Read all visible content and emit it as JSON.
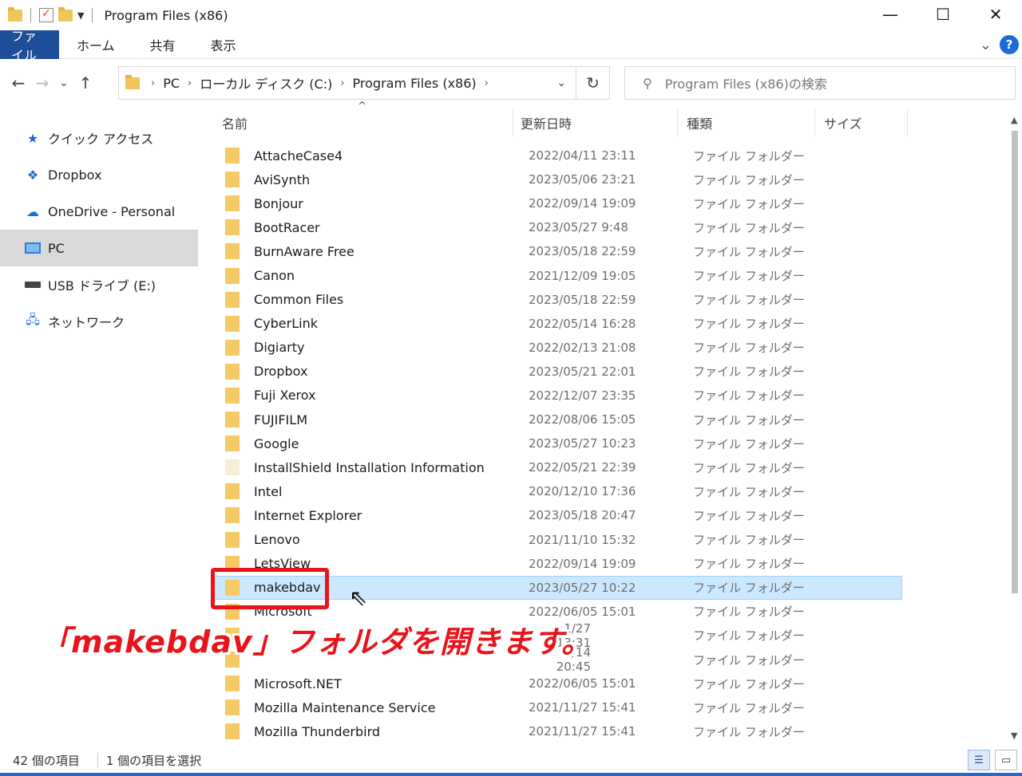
{
  "window": {
    "title": "Program Files (x86)",
    "minimize": "—",
    "maximize": "☐",
    "close": "✕"
  },
  "ribbon": {
    "tabs": [
      "ファイル",
      "ホーム",
      "共有",
      "表示"
    ],
    "expand": "⌄",
    "help": "?"
  },
  "nav": {
    "back": "←",
    "forward": "→",
    "recent": "⌄",
    "up": "↑",
    "breadcrumb": [
      "PC",
      "ローカル ディスク (C:)",
      "Program Files (x86)"
    ],
    "refresh": "↻",
    "search_placeholder": "Program Files (x86)の検索"
  },
  "sidebar": {
    "items": [
      "クイック アクセス",
      "Dropbox",
      "OneDrive - Personal",
      "PC",
      "USB ドライブ (E:)",
      "ネットワーク"
    ]
  },
  "columns": {
    "name": "名前",
    "date": "更新日時",
    "type": "種類",
    "size": "サイズ",
    "sort_indicator": "^"
  },
  "files": [
    {
      "name": "AttacheCase4",
      "date": "2022/04/11 23:11",
      "type": "ファイル フォルダー"
    },
    {
      "name": "AviSynth",
      "date": "2023/05/06 23:21",
      "type": "ファイル フォルダー"
    },
    {
      "name": "Bonjour",
      "date": "2022/09/14 19:09",
      "type": "ファイル フォルダー"
    },
    {
      "name": "BootRacer",
      "date": "2023/05/27 9:48",
      "type": "ファイル フォルダー"
    },
    {
      "name": "BurnAware Free",
      "date": "2023/05/18 22:59",
      "type": "ファイル フォルダー"
    },
    {
      "name": "Canon",
      "date": "2021/12/09 19:05",
      "type": "ファイル フォルダー"
    },
    {
      "name": "Common Files",
      "date": "2023/05/18 22:59",
      "type": "ファイル フォルダー"
    },
    {
      "name": "CyberLink",
      "date": "2022/05/14 16:28",
      "type": "ファイル フォルダー"
    },
    {
      "name": "Digiarty",
      "date": "2022/02/13 21:08",
      "type": "ファイル フォルダー"
    },
    {
      "name": "Dropbox",
      "date": "2023/05/21 22:01",
      "type": "ファイル フォルダー"
    },
    {
      "name": "Fuji Xerox",
      "date": "2022/12/07 23:35",
      "type": "ファイル フォルダー"
    },
    {
      "name": "FUJIFILM",
      "date": "2022/08/06 15:05",
      "type": "ファイル フォルダー"
    },
    {
      "name": "Google",
      "date": "2023/05/27 10:23",
      "type": "ファイル フォルダー"
    },
    {
      "name": "InstallShield Installation Information",
      "date": "2022/05/21 22:39",
      "type": "ファイル フォルダー"
    },
    {
      "name": "Intel",
      "date": "2020/12/10 17:36",
      "type": "ファイル フォルダー"
    },
    {
      "name": "Internet Explorer",
      "date": "2023/05/18 20:47",
      "type": "ファイル フォルダー"
    },
    {
      "name": "Lenovo",
      "date": "2021/11/10 15:32",
      "type": "ファイル フォルダー"
    },
    {
      "name": "LetsView",
      "date": "2022/09/14 19:09",
      "type": "ファイル フォルダー"
    },
    {
      "name": "makebdav",
      "date": "2023/05/27 10:22",
      "type": "ファイル フォルダー"
    },
    {
      "name": "Microsoft",
      "date": "2022/06/05 15:01",
      "type": "ファイル フォルダー"
    },
    {
      "name": "",
      "date": "1/27 13:31",
      "type": "ファイル フォルダー"
    },
    {
      "name": "",
      "date": "5/14 20:45",
      "type": "ファイル フォルダー"
    },
    {
      "name": "Microsoft.NET",
      "date": "2022/06/05 15:01",
      "type": "ファイル フォルダー"
    },
    {
      "name": "Mozilla Maintenance Service",
      "date": "2021/11/27 15:41",
      "type": "ファイル フォルダー"
    },
    {
      "name": "Mozilla Thunderbird",
      "date": "2021/11/27 15:41",
      "type": "ファイル フォルダー"
    }
  ],
  "status": {
    "count": "42 個の項目",
    "selected": "1 個の項目を選択"
  },
  "annotation": {
    "caption": "「makebdav」フォルダを開きます。",
    "color": "#e8141b"
  }
}
